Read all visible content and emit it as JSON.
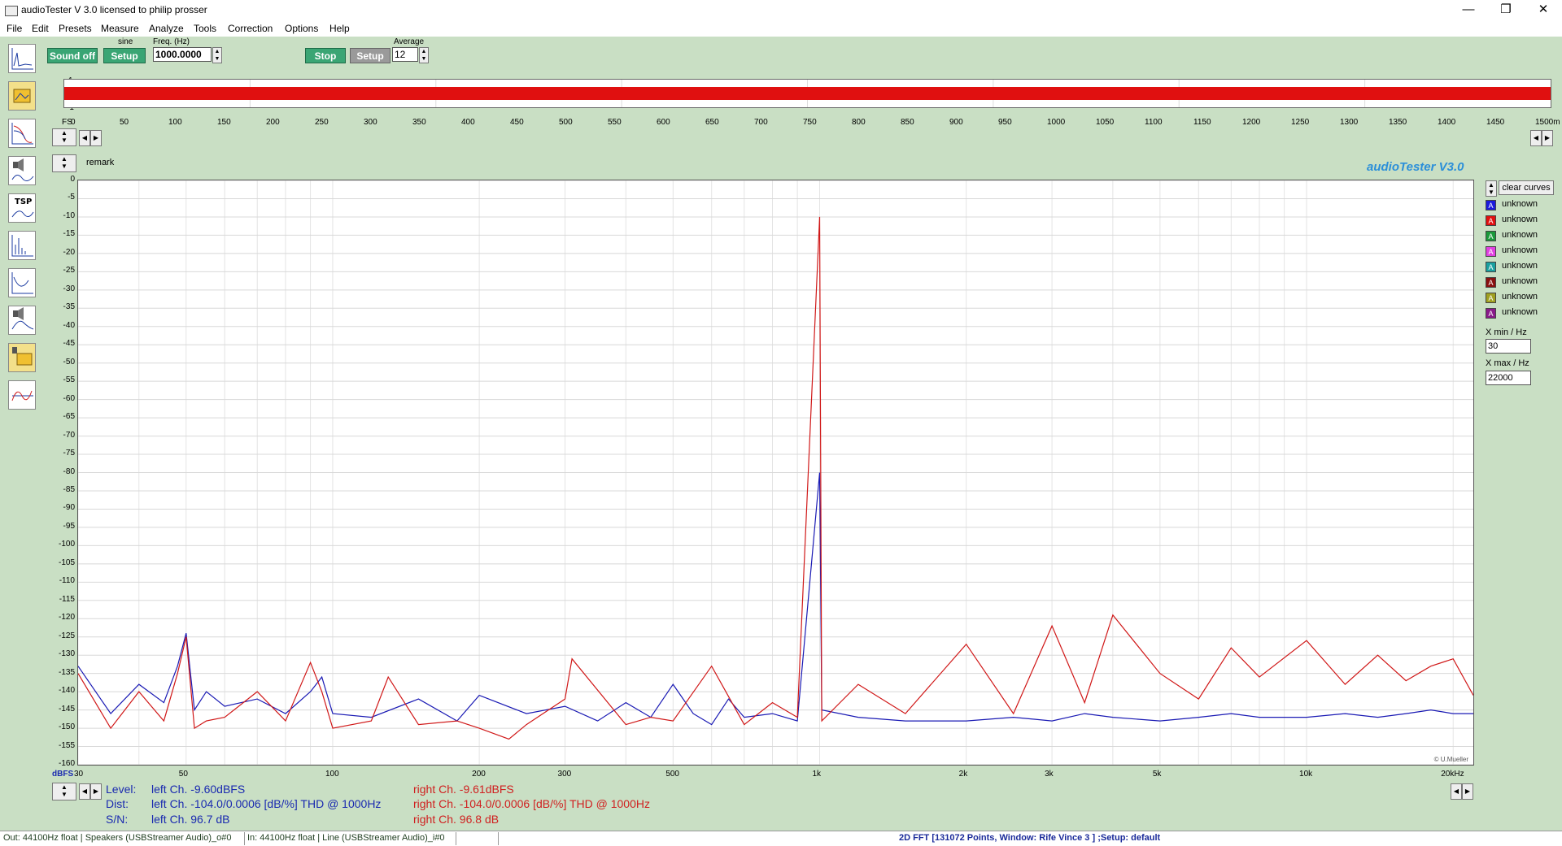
{
  "window": {
    "title": "audioTester  V 3.0   licensed to philip prosser",
    "minimize": "—",
    "restore": "❐",
    "close": "✕"
  },
  "menu": [
    "File",
    "Edit",
    "Presets",
    "Measure",
    "Analyze",
    "Tools",
    "Correction",
    "Options",
    "Help"
  ],
  "toolbar": {
    "sound_off": "Sound off",
    "generator_type": "sine",
    "generator_setup": "Setup",
    "freq_label": "Freq. (Hz)",
    "freq_value": "1000.0000",
    "stop": "Stop",
    "analyzer_setup": "Setup",
    "average_label": "Average",
    "average_value": "12"
  },
  "waveform": {
    "y_ticks": [
      "1",
      "0",
      "-1"
    ],
    "x_ticks": [
      "FS",
      "0",
      "50",
      "100",
      "150",
      "200",
      "250",
      "300",
      "350",
      "400",
      "450",
      "500",
      "550",
      "600",
      "650",
      "700",
      "750",
      "800",
      "850",
      "900",
      "950",
      "1000",
      "1050",
      "1100",
      "1150",
      "1200",
      "1250",
      "1300",
      "1350",
      "1400",
      "1450",
      "1500m"
    ],
    "color": "#e01010"
  },
  "remark_label": "remark",
  "brand": "audioTester  V3.0",
  "credit": "© U.Mueller",
  "y_unit_label": "dBFS",
  "legend": {
    "clear_curves": "clear curves",
    "items": [
      {
        "label": "unknown",
        "color": "#1a1adc"
      },
      {
        "label": "unknown",
        "color": "#e01010"
      },
      {
        "label": "unknown",
        "color": "#1a9a3a"
      },
      {
        "label": "unknown",
        "color": "#e040e0"
      },
      {
        "label": "unknown",
        "color": "#1aa0a0"
      },
      {
        "label": "unknown",
        "color": "#8a1010"
      },
      {
        "label": "unknown",
        "color": "#a0a020"
      },
      {
        "label": "unknown",
        "color": "#8a1a8a"
      }
    ],
    "xmin_label": "X min / Hz",
    "xmin_value": "30",
    "xmax_label": "X max / Hz",
    "xmax_value": "22000"
  },
  "chart_data": {
    "type": "line",
    "xlabel": "",
    "ylabel": "dBFS",
    "x_scale": "log",
    "xlim": [
      30,
      22000
    ],
    "ylim": [
      -160,
      0
    ],
    "y_ticks": [
      0,
      -5,
      -10,
      -15,
      -20,
      -25,
      -30,
      -35,
      -40,
      -45,
      -50,
      -55,
      -60,
      -65,
      -70,
      -75,
      -80,
      -85,
      -90,
      -95,
      -100,
      -105,
      -110,
      -115,
      -120,
      -125,
      -130,
      -135,
      -140,
      -145,
      -150,
      -155,
      -160
    ],
    "x_tick_labels": [
      "30",
      "50",
      "100",
      "200",
      "300",
      "500",
      "1k",
      "2k",
      "3k",
      "5k",
      "10k",
      "20kHz"
    ],
    "x_tick_values": [
      30,
      50,
      100,
      200,
      300,
      500,
      1000,
      2000,
      3000,
      5000,
      10000,
      20000
    ],
    "grid": true,
    "series": [
      {
        "name": "left Ch.",
        "color": "#1a1ab4",
        "x": [
          30,
          35,
          40,
          45,
          48,
          50,
          52,
          55,
          60,
          70,
          80,
          90,
          95,
          100,
          120,
          150,
          180,
          200,
          250,
          300,
          350,
          400,
          450,
          500,
          550,
          600,
          650,
          700,
          800,
          900,
          1000,
          1010,
          1200,
          1500,
          2000,
          2500,
          3000,
          3500,
          4000,
          5000,
          6000,
          7000,
          8000,
          10000,
          12000,
          14000,
          16000,
          18000,
          20000,
          22000
        ],
        "y": [
          -133,
          -146,
          -138,
          -143,
          -133,
          -124,
          -145,
          -140,
          -144,
          -142,
          -146,
          -140,
          -136,
          -146,
          -147,
          -142,
          -148,
          -141,
          -146,
          -144,
          -148,
          -143,
          -147,
          -138,
          -146,
          -149,
          -142,
          -147,
          -146,
          -148,
          -80,
          -145,
          -147,
          -148,
          -148,
          -147,
          -148,
          -146,
          -147,
          -148,
          -147,
          -146,
          -147,
          -147,
          -146,
          -147,
          -146,
          -145,
          -146,
          -146
        ]
      },
      {
        "name": "right Ch.",
        "color": "#d01818",
        "x": [
          30,
          35,
          40,
          45,
          48,
          50,
          52,
          55,
          60,
          70,
          80,
          90,
          95,
          100,
          120,
          130,
          150,
          180,
          200,
          230,
          250,
          300,
          310,
          400,
          450,
          500,
          600,
          700,
          800,
          900,
          1000,
          1010,
          1200,
          1500,
          2000,
          2500,
          3000,
          3500,
          4000,
          5000,
          6000,
          7000,
          8000,
          10000,
          12000,
          14000,
          16000,
          18000,
          20000,
          22000
        ],
        "y": [
          -135,
          -150,
          -140,
          -148,
          -135,
          -125,
          -150,
          -148,
          -147,
          -140,
          -148,
          -132,
          -140,
          -150,
          -148,
          -136,
          -149,
          -148,
          -150,
          -153,
          -149,
          -142,
          -131,
          -149,
          -147,
          -148,
          -133,
          -149,
          -143,
          -147,
          -10,
          -148,
          -138,
          -146,
          -127,
          -146,
          -122,
          -143,
          -119,
          -135,
          -142,
          -128,
          -136,
          -126,
          -138,
          -130,
          -137,
          -133,
          -131,
          -141
        ]
      }
    ]
  },
  "bottom_labels": {
    "level": "Level:",
    "dist": "Dist:",
    "sn": "S/N:",
    "left_level": "left Ch.  -9.60dBFS",
    "left_dist": "left Ch.  -104.0/0.0006 [dB/%] THD @ 1000Hz",
    "left_sn": "left Ch.  96.7 dB",
    "right_level": "right Ch.  -9.61dBFS",
    "right_dist": "right Ch.  -104.0/0.0006 [dB/%] THD @ 1000Hz",
    "right_sn": "right Ch.  96.8 dB"
  },
  "status": {
    "out": "Out: 44100Hz float  | Speakers (USBStreamer Audio)_o#0",
    "in": "In: 44100Hz float  | Line (USBStreamer Audio)_i#0",
    "fft": "2D FFT [131072 Points, Window: Rife Vince 3 ]  ;Setup:  default"
  }
}
